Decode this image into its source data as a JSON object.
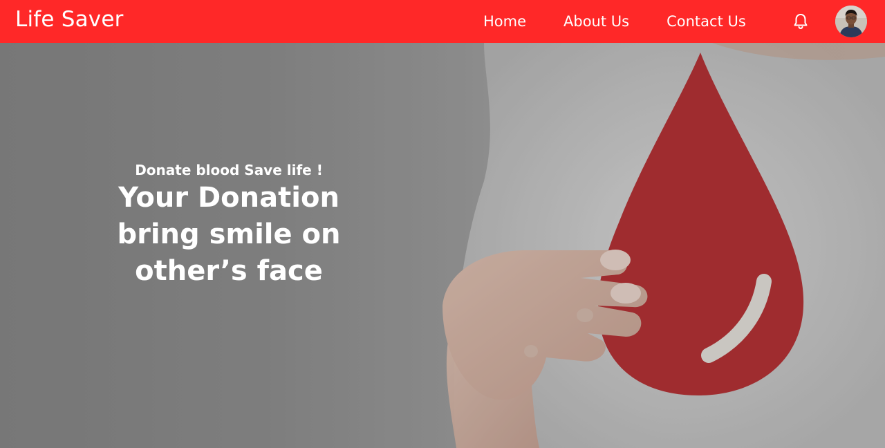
{
  "navbar": {
    "brand": "Life Saver",
    "links": [
      "Home",
      "About Us",
      "Contact Us"
    ],
    "background_color": "#ff2828"
  },
  "icons": {
    "bell": "bell-icon",
    "avatar": "user-avatar"
  },
  "hero": {
    "tagline": "Donate blood Save life !",
    "headline_lines": [
      "Your Donation",
      "bring smile on",
      "other’s face"
    ],
    "drop_color": "#b5292c"
  }
}
